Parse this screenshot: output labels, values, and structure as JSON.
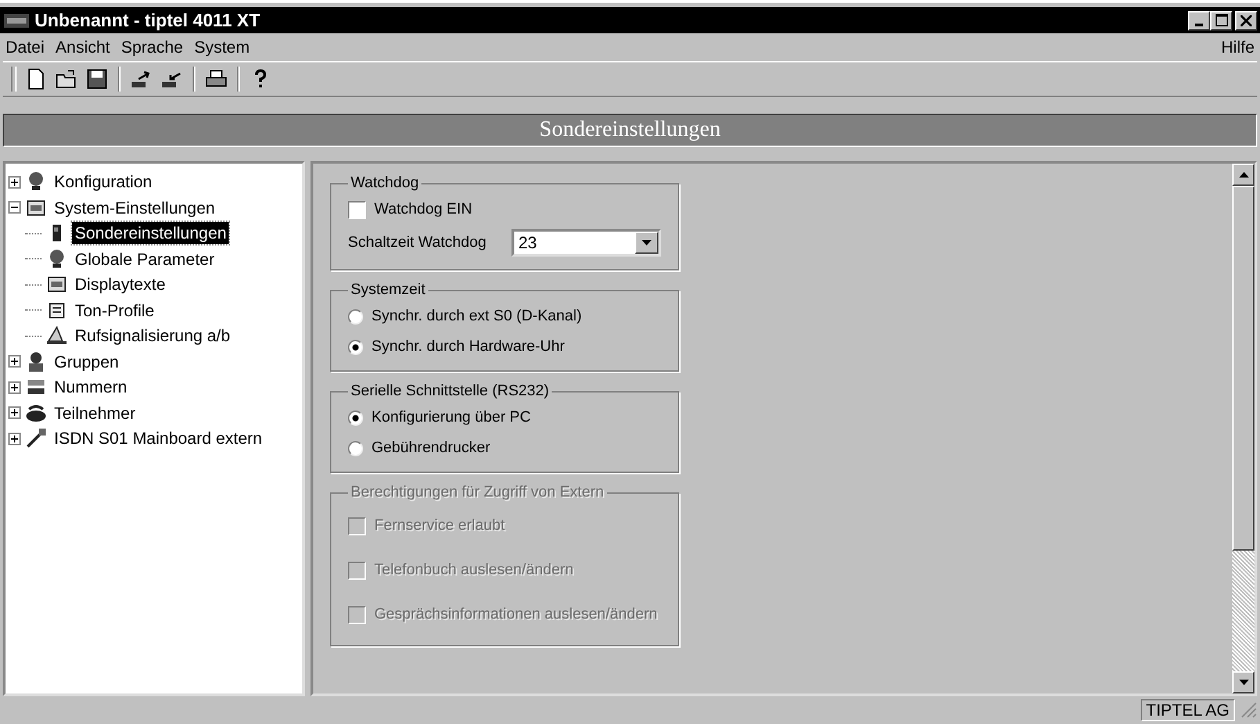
{
  "window": {
    "title": "Unbenannt - tiptel 4011 XT"
  },
  "menu": {
    "left": [
      "Datei",
      "Ansicht",
      "Sprache",
      "System"
    ],
    "right": [
      "Hilfe"
    ]
  },
  "toolbar": [
    {
      "kind": "new"
    },
    {
      "kind": "open"
    },
    {
      "kind": "save"
    },
    {
      "kind": "sep"
    },
    {
      "kind": "upload"
    },
    {
      "kind": "download"
    },
    {
      "kind": "sep"
    },
    {
      "kind": "print"
    },
    {
      "kind": "sep"
    },
    {
      "kind": "help"
    }
  ],
  "header": "Sondereinstellungen",
  "tree": [
    {
      "label": "Konfiguration",
      "expanded": false,
      "selected": false
    },
    {
      "label": "System-Einstellungen",
      "expanded": true,
      "selected": false,
      "children": [
        {
          "label": "Sondereinstellungen",
          "selected": true
        },
        {
          "label": "Globale Parameter",
          "selected": false
        },
        {
          "label": "Displaytexte",
          "selected": false
        },
        {
          "label": "Ton-Profile",
          "selected": false
        },
        {
          "label": "Rufsignalisierung a/b",
          "selected": false
        }
      ]
    },
    {
      "label": "Gruppen",
      "expanded": false,
      "selected": false
    },
    {
      "label": "Nummern",
      "expanded": false,
      "selected": false
    },
    {
      "label": "Teilnehmer",
      "expanded": false,
      "selected": false
    },
    {
      "label": "ISDN S01 Mainboard extern",
      "expanded": false,
      "selected": false
    }
  ],
  "groups": [
    {
      "title": "Watchdog",
      "disabled": false,
      "items": [
        {
          "kind": "checkbox",
          "label": "Watchdog EIN",
          "checked": false
        },
        {
          "kind": "select",
          "label": "Schaltzeit Watchdog",
          "value": "23"
        }
      ]
    },
    {
      "title": "Systemzeit",
      "disabled": false,
      "items": [
        {
          "kind": "radio",
          "label": "Synchr. durch ext S0 (D-Kanal)",
          "selected": false
        },
        {
          "kind": "radio",
          "label": "Synchr. durch Hardware-Uhr",
          "selected": true
        }
      ]
    },
    {
      "title": "Serielle Schnittstelle (RS232)",
      "disabled": false,
      "items": [
        {
          "kind": "radio",
          "label": "Konfigurierung über PC",
          "selected": true
        },
        {
          "kind": "radio",
          "label": "Gebührendrucker",
          "selected": false
        }
      ]
    },
    {
      "title": "Berechtigungen für Zugriff von Extern",
      "disabled": true,
      "items": [
        {
          "kind": "checkbox",
          "label": "Fernservice erlaubt",
          "checked": false
        },
        {
          "kind": "checkbox",
          "label": "Telefonbuch auslesen/ändern",
          "checked": false
        },
        {
          "kind": "checkbox",
          "label": "Gesprächsinformationen auslesen/ändern",
          "checked": false
        }
      ]
    }
  ],
  "status_bar": {
    "text": "TIPTEL AG"
  }
}
